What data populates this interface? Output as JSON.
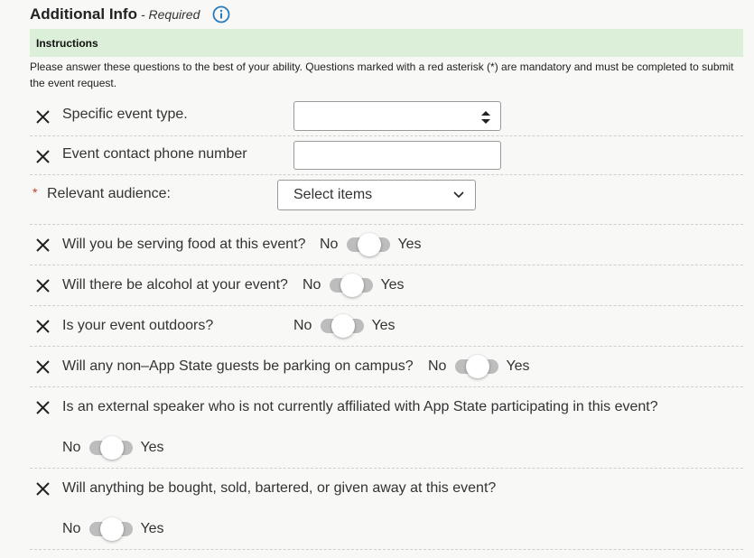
{
  "header": {
    "title": "Additional Info",
    "required": "- Required",
    "info_icon": "info-circle-icon"
  },
  "instructions": {
    "heading": "Instructions",
    "text": "Please answer these questions to the best of your ability.  Questions marked with a red asterisk (*) are mandatory and must be completed to submit the event request."
  },
  "fields": {
    "event_type": {
      "label": "Specific event type.",
      "value": ""
    },
    "phone": {
      "label": "Event contact phone number",
      "value": ""
    },
    "audience": {
      "asterisk": "*",
      "label": "Relevant audience:",
      "placeholder": "Select items"
    }
  },
  "toggles": {
    "no_label": "No",
    "yes_label": "Yes",
    "items": [
      {
        "label": "Will you be serving food at this event?"
      },
      {
        "label": "Will there be alcohol at your event?"
      },
      {
        "label": "Is your event outdoors?"
      },
      {
        "label": "Will any non–App State guests be parking on campus?"
      },
      {
        "label": "Is an external speaker who is not currently affiliated with App State participating in this event?"
      },
      {
        "label": "Will anything be bought, sold, bartered, or given away at this event?"
      }
    ]
  },
  "colors": {
    "instructions_bg": "#dcefd8",
    "info_icon": "#2a7ab8",
    "asterisk": "#c0392b",
    "toggle_track": "#bdbdbd"
  }
}
